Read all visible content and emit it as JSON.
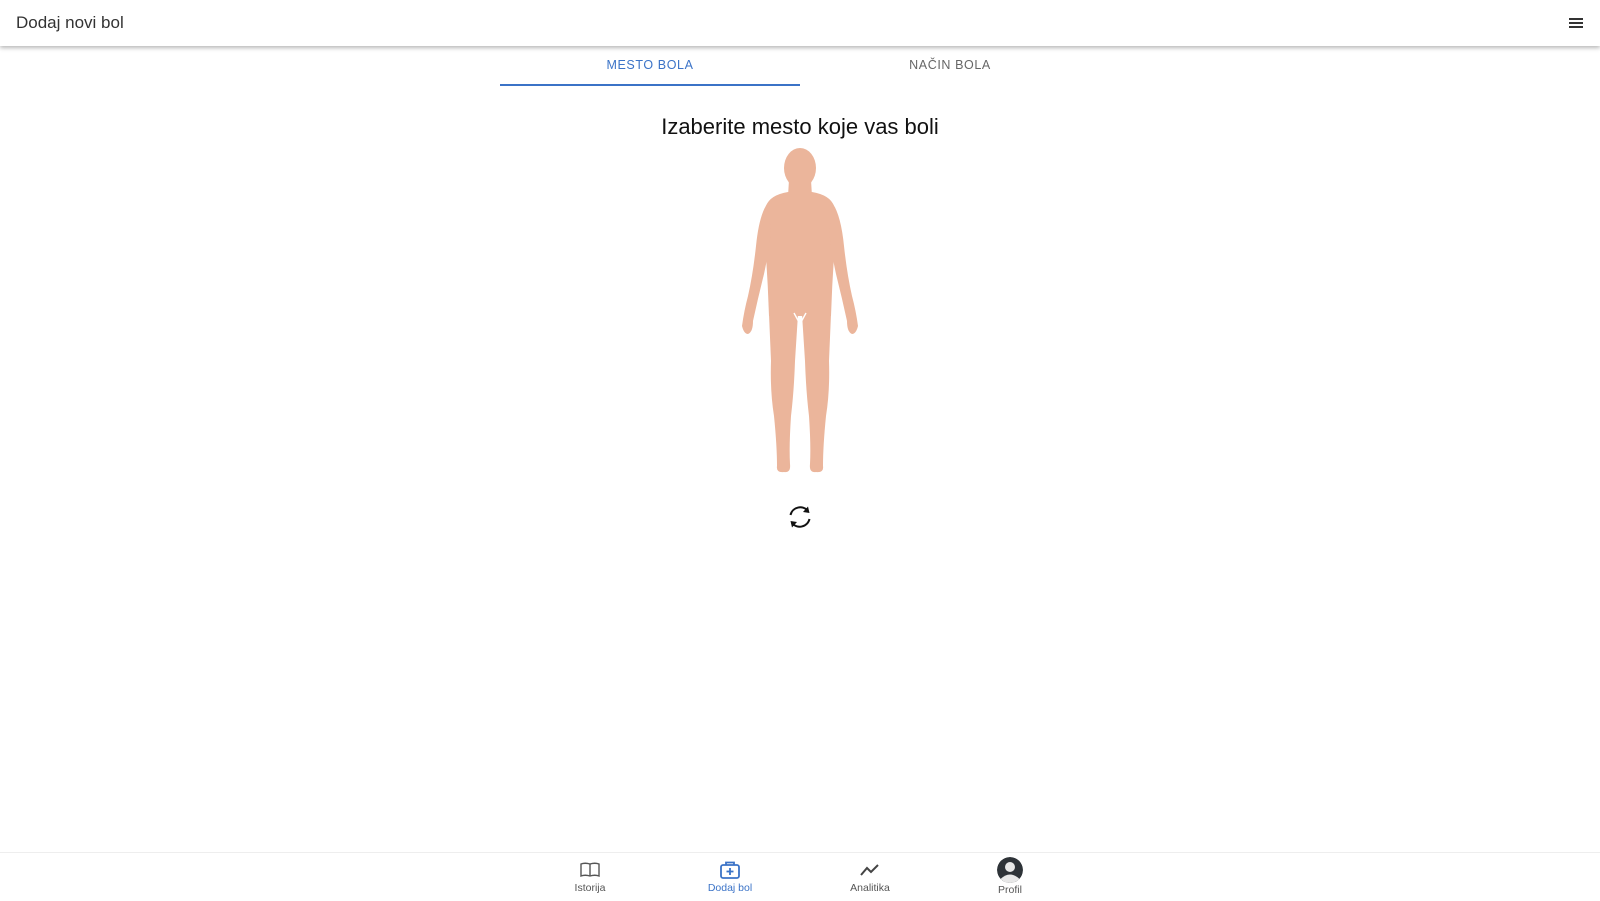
{
  "app_bar": {
    "title": "Dodaj novi bol",
    "menu_icon": "menu-icon"
  },
  "tabs": [
    {
      "label": "MESTO BOLA",
      "active": true
    },
    {
      "label": "NAČIN BOLA",
      "active": false
    }
  ],
  "main": {
    "prompt": "Izaberite mesto koje vas boli",
    "figure_icon": "human-body-front",
    "rotate_icon": "rotate-icon"
  },
  "bottom_nav": {
    "items": [
      {
        "label": "Istorija",
        "icon": "book-icon",
        "active": false
      },
      {
        "label": "Dodaj bol",
        "icon": "medical-kit-icon",
        "active": true
      },
      {
        "label": "Analitika",
        "icon": "trend-icon",
        "active": false
      },
      {
        "label": "Profil",
        "icon": "avatar",
        "active": false
      }
    ]
  },
  "colors": {
    "accent": "#3b73c7",
    "skin": "#ebb59b",
    "text_dark": "#111111",
    "text_muted": "#666666"
  }
}
